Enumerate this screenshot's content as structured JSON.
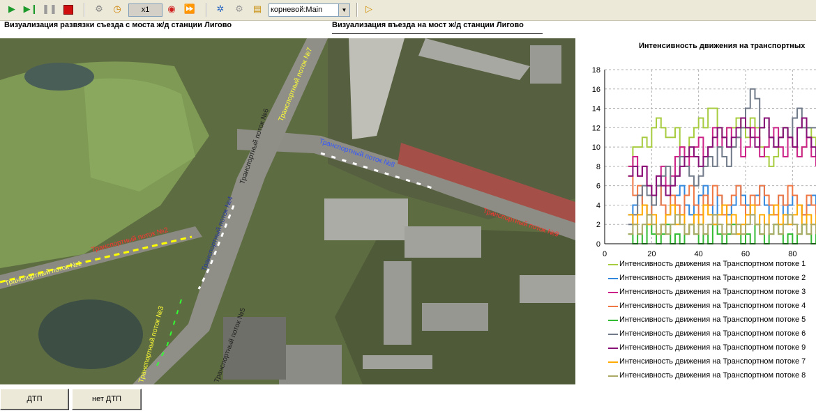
{
  "toolbar": {
    "icons": [
      "play-icon",
      "step-icon",
      "pause-icon",
      "stop-icon",
      "settings-icon",
      "clock-icon",
      "record-icon",
      "fast-forward-icon",
      "tools-icon",
      "gear-icon",
      "folder-icon",
      "debug-icon"
    ],
    "speed": "x1",
    "context": "корневой:Main"
  },
  "views": {
    "left": "Визуализация развязки съезда с моста ж/д станции Лигово",
    "right": "Визуализация въезда на мост ж/д станции Лигово"
  },
  "map": {
    "labels": [
      {
        "text": "Транспортный поток №1",
        "color": "#ffff66"
      },
      {
        "text": "Транспортный поток №2",
        "color": "#ff3333"
      },
      {
        "text": "Транспортный поток №3",
        "color": "#ffff33"
      },
      {
        "text": "Транспортный поток №4",
        "color": "#2a3a9a"
      },
      {
        "text": "Транспортный поток №5",
        "color": "#222222"
      },
      {
        "text": "Транспортный поток №6",
        "color": "#222222"
      },
      {
        "text": "Транспортный поток №7",
        "color": "#ffff33"
      },
      {
        "text": "Транспортный поток №8",
        "color": "#3355ff"
      },
      {
        "text": "Транспортный поток №9",
        "color": "#ff3333"
      }
    ]
  },
  "chart_data": {
    "type": "line",
    "title": "Интенсивность движения на транспортных",
    "xlim": [
      0,
      90
    ],
    "ylim": [
      0,
      18
    ],
    "xticks": [
      0,
      20,
      40,
      60,
      80
    ],
    "yticks": [
      0,
      2,
      4,
      6,
      8,
      10,
      12,
      14,
      16,
      18
    ],
    "grid": true,
    "x": [
      10,
      12,
      14,
      16,
      18,
      20,
      22,
      24,
      26,
      28,
      30,
      32,
      34,
      36,
      38,
      40,
      42,
      44,
      46,
      48,
      50,
      52,
      54,
      56,
      58,
      60,
      62,
      64,
      66,
      68,
      70,
      72,
      74,
      76,
      78,
      80,
      82,
      84,
      86,
      88,
      90
    ],
    "series": [
      {
        "name": "Интенсивность движения на Транспортном потоке 1",
        "color": "#a8cc40",
        "values": [
          8,
          10,
          10,
          11,
          10,
          12,
          13,
          12,
          11,
          11,
          12,
          10,
          9,
          11,
          12,
          13,
          12,
          14,
          14,
          12,
          11,
          12,
          12,
          13,
          12,
          11,
          13,
          12,
          10,
          9,
          8,
          9,
          11,
          12,
          11,
          10,
          9,
          10,
          12,
          11,
          10
        ]
      },
      {
        "name": "Интенсивность движения на Транспортном потоке 2",
        "color": "#3388dd",
        "values": [
          3,
          4,
          5,
          4,
          3,
          5,
          6,
          4,
          3,
          4,
          5,
          6,
          4,
          3,
          4,
          5,
          6,
          4,
          3,
          5,
          4,
          3,
          4,
          6,
          5,
          4,
          3,
          5,
          6,
          4,
          3,
          4,
          5,
          3,
          4,
          5,
          4,
          3,
          4,
          5,
          4
        ]
      },
      {
        "name": "Интенсивность движения на Транспортном потоке 3",
        "color": "#cc2288",
        "values": [
          8,
          9,
          7,
          8,
          6,
          5,
          7,
          8,
          6,
          7,
          9,
          10,
          8,
          9,
          10,
          11,
          9,
          10,
          12,
          10,
          11,
          12,
          10,
          11,
          9,
          10,
          12,
          11,
          9,
          10,
          11,
          12,
          10,
          9,
          11,
          10,
          9,
          10,
          11,
          9,
          8
        ]
      },
      {
        "name": "Интенсивность движения на Транспортном потоке 4",
        "color": "#ee7744",
        "values": [
          7,
          5,
          6,
          4,
          3,
          5,
          6,
          4,
          3,
          5,
          4,
          3,
          5,
          6,
          4,
          3,
          5,
          4,
          6,
          5,
          3,
          4,
          5,
          6,
          4,
          3,
          5,
          4,
          6,
          5,
          4,
          3,
          5,
          4,
          6,
          5,
          4,
          3,
          5,
          4,
          3
        ]
      },
      {
        "name": "Интенсивность движения на Транспортном потоке 5",
        "color": "#33bb33",
        "values": [
          1,
          0,
          1,
          0,
          2,
          1,
          0,
          1,
          2,
          0,
          1,
          0,
          1,
          2,
          1,
          0,
          1,
          0,
          2,
          1,
          0,
          1,
          2,
          1,
          0,
          1,
          0,
          2,
          1,
          0,
          1,
          2,
          1,
          0,
          1,
          0,
          1,
          2,
          1,
          0,
          1
        ]
      },
      {
        "name": "Интенсивность движения на Транспортном потоке 6",
        "color": "#707a88",
        "values": [
          2,
          3,
          5,
          6,
          5,
          4,
          6,
          7,
          8,
          6,
          7,
          9,
          8,
          7,
          6,
          7,
          8,
          9,
          8,
          10,
          9,
          8,
          10,
          11,
          12,
          14,
          16,
          15,
          12,
          13,
          11,
          10,
          11,
          12,
          11,
          13,
          14,
          12,
          12,
          12,
          12
        ]
      },
      {
        "name": "Интенсивность движения на Транспортном потоке 9",
        "color": "#881177",
        "values": [
          7,
          8,
          7,
          8,
          6,
          5,
          7,
          6,
          5,
          6,
          7,
          8,
          9,
          10,
          9,
          8,
          9,
          10,
          11,
          12,
          11,
          10,
          11,
          12,
          13,
          12,
          11,
          10,
          12,
          13,
          11,
          10,
          11,
          12,
          11,
          10,
          12,
          13,
          11,
          10,
          9
        ]
      },
      {
        "name": "Интенсивность движения на Транспортном потоке 7",
        "color": "#ffaa00",
        "values": [
          3,
          2,
          3,
          4,
          2,
          3,
          1,
          2,
          3,
          4,
          2,
          3,
          1,
          2,
          3,
          2,
          4,
          3,
          2,
          3,
          4,
          2,
          3,
          1,
          2,
          3,
          4,
          2,
          3,
          2,
          3,
          4,
          2,
          3,
          2,
          3,
          4,
          2,
          3,
          2,
          3
        ]
      },
      {
        "name": "Интенсивность движения на Транспортном потоке 8",
        "color": "#aaaa66",
        "values": [
          1,
          2,
          1,
          2,
          3,
          2,
          1,
          2,
          1,
          2,
          3,
          2,
          1,
          2,
          1,
          2,
          1,
          2,
          3,
          2,
          1,
          2,
          1,
          2,
          1,
          2,
          3,
          2,
          1,
          2,
          1,
          2,
          1,
          2,
          3,
          2,
          1,
          2,
          1,
          2,
          1
        ]
      }
    ]
  },
  "buttons": {
    "accident": "ДТП",
    "no_accident": "нет ДТП"
  }
}
